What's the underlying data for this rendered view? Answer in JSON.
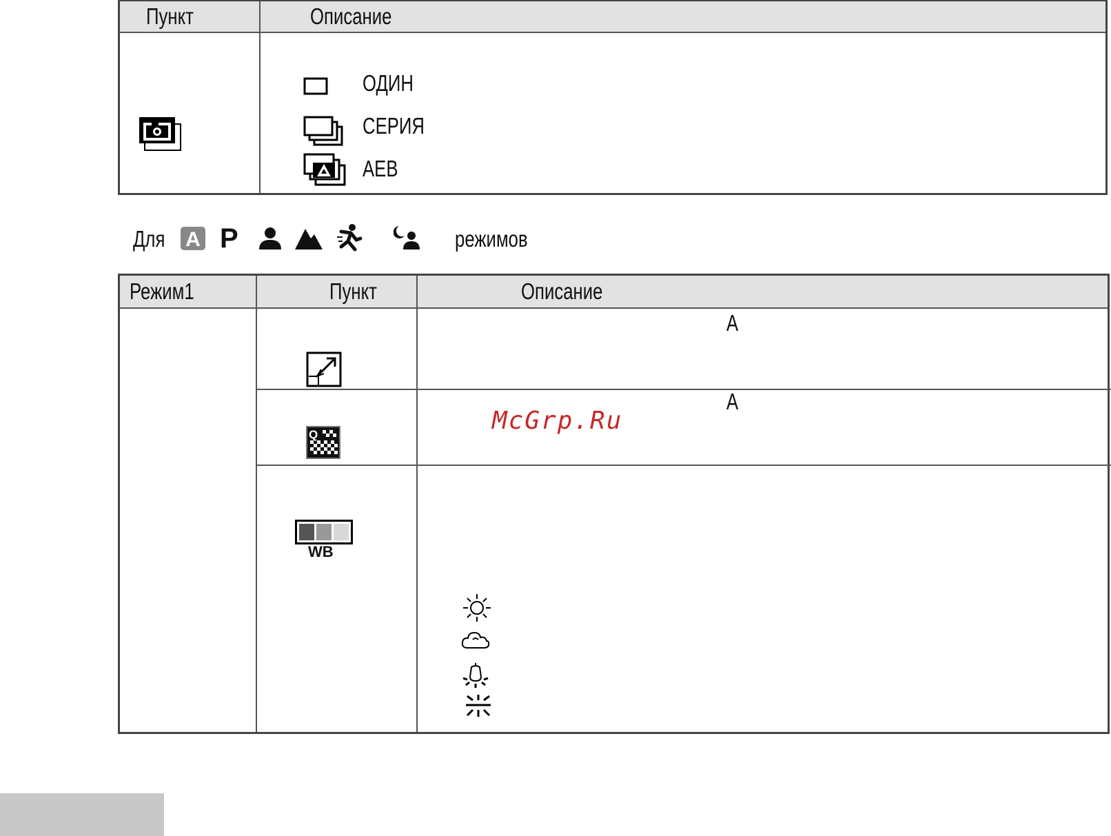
{
  "table1": {
    "headers": {
      "item": "Пункт",
      "description": "Описание"
    },
    "row_icon": "drive-mode-icon",
    "options": [
      {
        "icon": "single-frame-icon",
        "label": "ОДИН"
      },
      {
        "icon": "continuous-icon",
        "label": "СЕРИЯ"
      },
      {
        "icon": "aeb-icon",
        "label": "AEB"
      }
    ]
  },
  "modes_line": {
    "prefix": "Для",
    "mode_icons": [
      "auto-mode-icon",
      "program-mode-icon",
      "portrait-mode-icon",
      "landscape-mode-icon",
      "sport-mode-icon",
      "night-portrait-mode-icon"
    ],
    "auto_letter": "A",
    "program_letter": "P",
    "suffix": "режимов"
  },
  "table2": {
    "headers": {
      "mode": "Режим1",
      "item": "Пункт",
      "description": "Описание"
    },
    "rows": [
      {
        "icon": "image-size-icon",
        "mark": "A"
      },
      {
        "icon": "quality-icon",
        "icon_letter": "Q",
        "mark": "A"
      },
      {
        "icon": "white-balance-icon",
        "icon_label": "WB",
        "options": [
          "sunny-icon",
          "cloudy-icon",
          "tungsten-icon",
          "fluorescent-icon"
        ]
      }
    ]
  },
  "watermark": "McGrp.Ru"
}
